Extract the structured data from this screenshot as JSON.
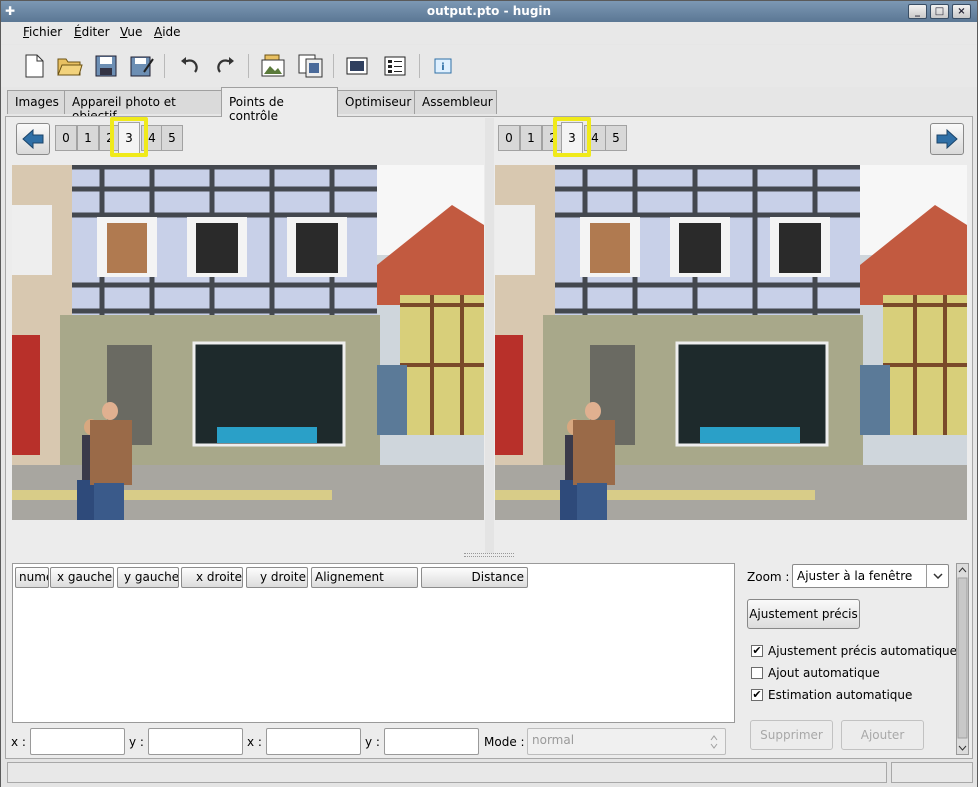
{
  "window": {
    "title": "output.pto - hugin",
    "minimize": "_",
    "maximize": "□",
    "close": "×",
    "app_icon": "hugin-icon"
  },
  "menu": [
    "Fichier",
    "Éditer",
    "Vue",
    "Aide"
  ],
  "toolbar_icons": [
    "new-file-icon",
    "open-folder-icon",
    "save-icon",
    "save-as-icon",
    "undo-icon",
    "redo-icon",
    "add-image-icon",
    "add-series-icon",
    "preview-icon",
    "gl-preview-icon",
    "info-icon"
  ],
  "tabs": [
    "Images",
    "Appareil photo et objectif",
    "Points de contrôle",
    "Optimiseur",
    "Assembleur"
  ],
  "active_tab": "Points de contrôle",
  "left_images": [
    "0",
    "1",
    "2",
    "3",
    "4",
    "5"
  ],
  "right_images": [
    "0",
    "1",
    "2",
    "3",
    "4",
    "5"
  ],
  "left_selected": "3",
  "right_selected": "3",
  "columns": [
    "numéro",
    "x gauche",
    "y gauche",
    "x droite",
    "y droite",
    "Alignement",
    "Distance"
  ],
  "bottom": {
    "x_label": "x :",
    "y_label": "y :",
    "mode_label": "Mode :",
    "mode_value": "normal"
  },
  "side": {
    "zoom_label": "Zoom :",
    "zoom_value": "Ajuster à la fenêtre",
    "fine_tune": "Ajustement précis",
    "auto_fine_tune": "Ajustement précis automatique",
    "auto_add": "Ajout automatique",
    "auto_estimate": "Estimation automatique",
    "auto_fine_tune_checked": true,
    "auto_add_checked": false,
    "auto_estimate_checked": true,
    "delete": "Supprimer",
    "add": "Ajouter"
  },
  "colors": {
    "title_bar": "#6b87a4",
    "highlight": "#f0ea1a",
    "nav_arrow": "#2f6fa6"
  }
}
